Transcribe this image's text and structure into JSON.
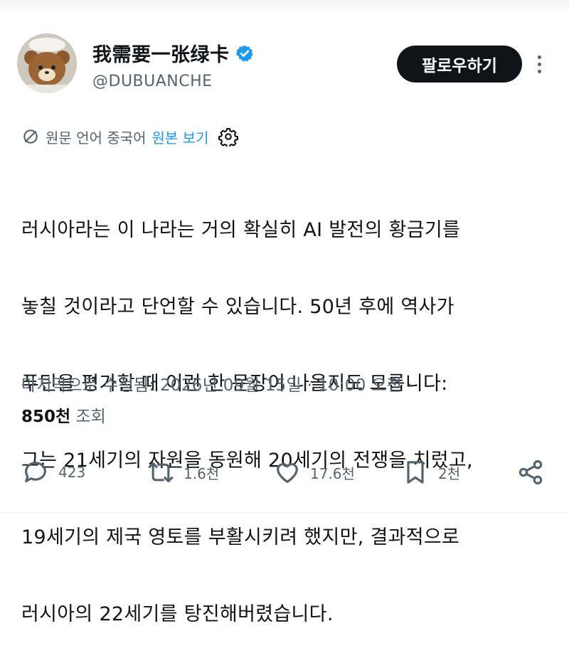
{
  "author": {
    "name": "我需要一张绿卡",
    "handle": "@DUBUANCHE",
    "verified": true,
    "follow_label": "팔로우하기"
  },
  "translation": {
    "original_language_label": "원문 언어 중국어",
    "show_original_label": "원본 보기"
  },
  "post": {
    "lines": [
      "러시아라는 이 나라는 거의 확실히 AI 발전의 황금기를",
      "놓칠 것이라고 단언할 수 있습니다. 50년 후에 역사가",
      "푸틴을 평가할 때 이런 한 문장이 나올지도 모릅니다:",
      "그는 21세기의 자원을 동원해 20세기의 전쟁을 치렀고,",
      "19세기의 제국 영토를 부활시키려 했지만, 결과적으로",
      "러시아의 22세기를 탕진해버렸습니다."
    ]
  },
  "meta": {
    "edited_text": "마지막으로 수정됨: 2026년 09월 15일 · 10:00 오전 ·",
    "views_count": "850천",
    "views_label": "조회"
  },
  "actions": {
    "replies": "423",
    "reposts": "1.6천",
    "likes": "17.6천",
    "bookmarks": "2천"
  },
  "colors": {
    "accent": "#1d9bf0",
    "text": "#0f1419",
    "muted": "#536471"
  }
}
